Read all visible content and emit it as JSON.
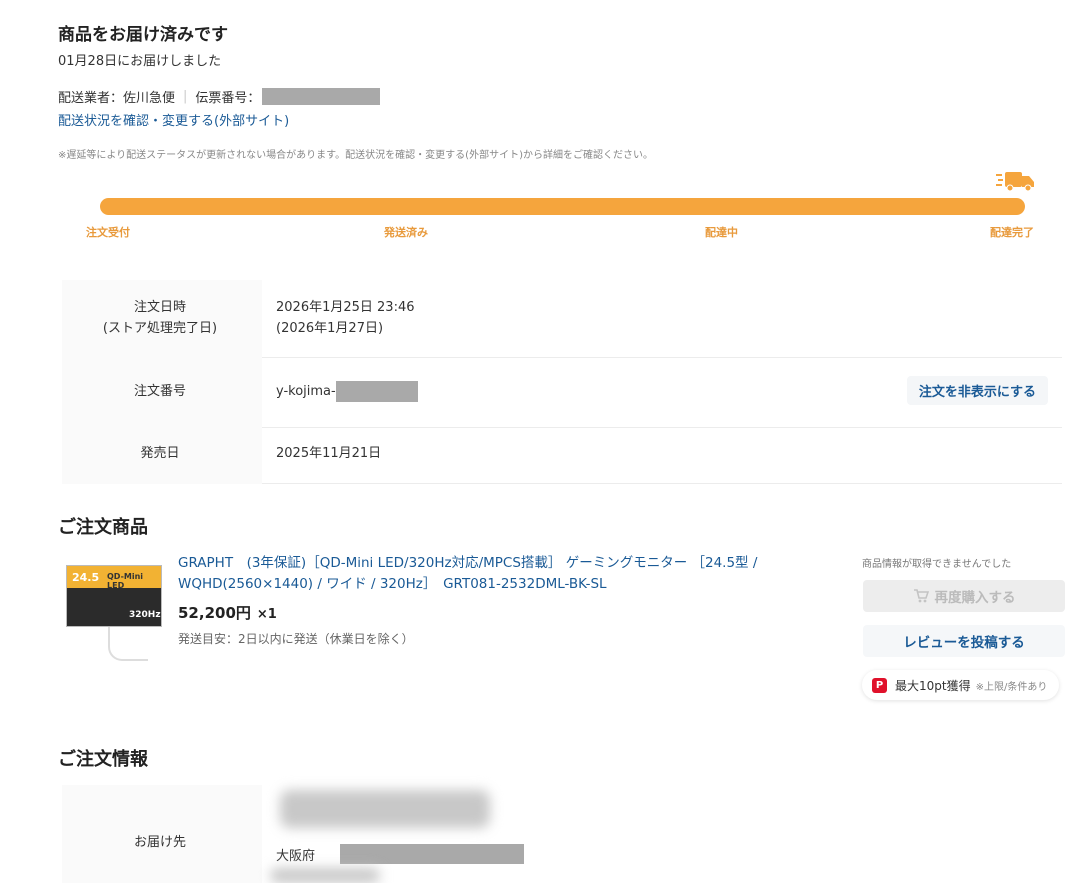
{
  "status": {
    "title": "商品をお届け済みです",
    "delivered_date": "01月28日にお届けしました",
    "carrier": "配送業者：佐川急便",
    "tracking_label": "伝票番号：",
    "tracking_link": "配送状況を確認・変更する(外部サイト)",
    "notice": "※遅延等により配送ステータスが更新されない場合があります。配送状況を確認・変更する(外部サイト)から詳細をご確認ください。"
  },
  "progress": {
    "value": 1.0,
    "color": "#f5a53d",
    "icon": "truck-icon",
    "steps": [
      "注文受付",
      "発送済み",
      "配達中",
      "配達完了"
    ]
  },
  "order": {
    "date_label_1": "注文日時",
    "date_label_2": "(ストア処理完了日)",
    "date_value_1": "2026年1月25日 23:46",
    "date_value_2": "(2026年1月27日)",
    "number_label": "注文番号",
    "number_prefix": "y-kojima-",
    "hide_button": "注文を非表示にする",
    "release_label": "発売日",
    "release_value": "2025年11月21日"
  },
  "products_section": {
    "title": "ご注文商品",
    "item": {
      "name": "GRAPHT　(3年保証)［QD-Mini LED/320Hz対応/MPCS搭載］ ゲーミングモニター ［24.5型 / WQHD(2560×1440) / ワイド / 320Hz］　GRT081-2532DML-BK-SL",
      "price": "52,200円",
      "qty": "×1",
      "ship_estimate": "発送目安：2日以内に発送（休業日を除く）",
      "thumb_text_1": "24.5",
      "thumb_text_2": "QD-Mini LED",
      "thumb_text_3": "320Hz"
    },
    "unavailable_note": "商品情報が取得できませんでした",
    "rebuy_button": "再度購入する",
    "review_button": "レビューを投稿する",
    "points_text": "最大10pt獲得",
    "points_note": "※上限/条件あり",
    "pay_icon_glyph": "P"
  },
  "order_info": {
    "title": "ご注文情報",
    "delivery_label": "お届け先",
    "address_prefix": "大阪府"
  },
  "colors": {
    "link": "#1a5a96",
    "accent": "#f5a53d",
    "step_label": "#e89a3c"
  }
}
